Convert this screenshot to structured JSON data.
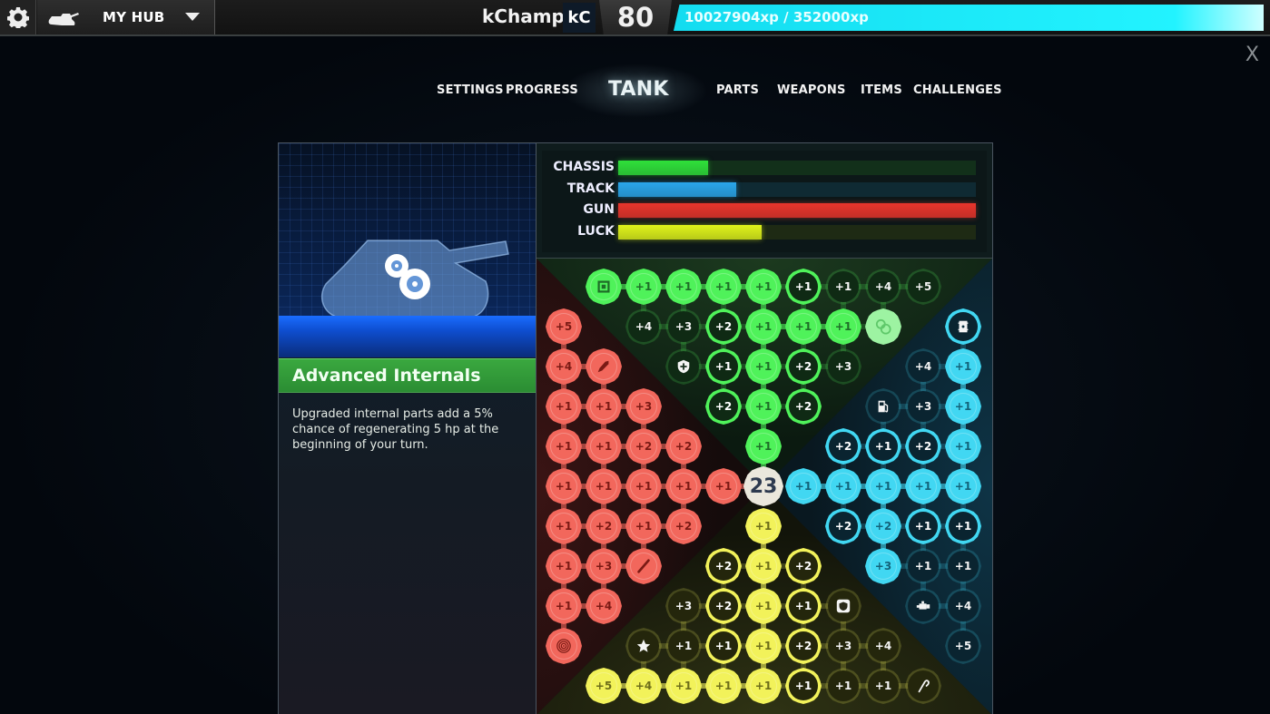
{
  "topbar": {
    "settings_icon": "gear-icon",
    "hub_icon": "tank-icon",
    "hub_label": "MY HUB",
    "hub_dropdown_icon": "caret-down-icon",
    "username": "kChamp",
    "user_badge": "kC",
    "level": "80",
    "xp_text": "10027904xp / 352000xp",
    "xp_progress_percent": 100,
    "xp_color": "#22f3ff"
  },
  "close_label": "X",
  "tabs": [
    {
      "label": "SETTINGS",
      "active": false
    },
    {
      "label": "PROGRESS",
      "active": false
    },
    {
      "label": "TANK",
      "active": true
    },
    {
      "label": "PARTS",
      "active": false
    },
    {
      "label": "WEAPONS",
      "active": false
    },
    {
      "label": "ITEMS",
      "active": false
    },
    {
      "label": "CHALLENGES",
      "active": false
    }
  ],
  "selected_part": {
    "icon": "gears-icon",
    "title": "Advanced Internals",
    "description": "Upgraded internal parts add a 5% chance of regenerating 5 hp at the beginning of your turn."
  },
  "stats": [
    {
      "label": "CHASSIS",
      "percent": 25,
      "color": "#2fe03a",
      "track": "#12301a"
    },
    {
      "label": "TRACK",
      "percent": 33,
      "color": "#2aa6ea",
      "track": "#0f2a33"
    },
    {
      "label": "GUN",
      "percent": 100,
      "color": "#e8352c",
      "track": "#301414"
    },
    {
      "label": "LUCK",
      "percent": 40,
      "color": "#dff21a",
      "track": "#1e2a14"
    }
  ],
  "colors": {
    "green": "#4ff25a",
    "red": "#f2675c",
    "cyan": "#41d7f2",
    "yellow": "#f2f25a"
  },
  "center_points": "23",
  "nodes": [
    {
      "r": 0,
      "c": 1,
      "color": "green",
      "state": "full",
      "icon": "chip-icon"
    },
    {
      "r": 0,
      "c": 2,
      "color": "green",
      "state": "full",
      "label": "+1"
    },
    {
      "r": 0,
      "c": 3,
      "color": "green",
      "state": "full",
      "label": "+1"
    },
    {
      "r": 0,
      "c": 4,
      "color": "green",
      "state": "full",
      "label": "+1"
    },
    {
      "r": 0,
      "c": 5,
      "color": "green",
      "state": "full",
      "label": "+1"
    },
    {
      "r": 0,
      "c": 6,
      "color": "green",
      "state": "mid",
      "label": "+1"
    },
    {
      "r": 0,
      "c": 7,
      "color": "green",
      "state": "dim",
      "label": "+1"
    },
    {
      "r": 0,
      "c": 8,
      "color": "green",
      "state": "dim",
      "label": "+4"
    },
    {
      "r": 0,
      "c": 9,
      "color": "green",
      "state": "dim",
      "label": "+5"
    },
    {
      "r": 1,
      "c": 0,
      "color": "red",
      "state": "full",
      "label": "+5"
    },
    {
      "r": 1,
      "c": 2,
      "color": "green",
      "state": "dim",
      "label": "+4"
    },
    {
      "r": 1,
      "c": 3,
      "color": "green",
      "state": "dim",
      "label": "+3"
    },
    {
      "r": 1,
      "c": 4,
      "color": "green",
      "state": "mid",
      "label": "+2"
    },
    {
      "r": 1,
      "c": 5,
      "color": "green",
      "state": "full",
      "label": "+1"
    },
    {
      "r": 1,
      "c": 6,
      "color": "green",
      "state": "full",
      "label": "+1"
    },
    {
      "r": 1,
      "c": 7,
      "color": "green",
      "state": "full",
      "label": "+1"
    },
    {
      "r": 1,
      "c": 8,
      "color": "green",
      "state": "selected",
      "icon": "gears-icon"
    },
    {
      "r": 1,
      "c": 10,
      "color": "cyan",
      "state": "mid",
      "icon": "barrel-icon"
    },
    {
      "r": 2,
      "c": 0,
      "color": "red",
      "state": "full",
      "label": "+4"
    },
    {
      "r": 2,
      "c": 1,
      "color": "red",
      "state": "full",
      "icon": "rocket-icon"
    },
    {
      "r": 2,
      "c": 3,
      "color": "green",
      "state": "dim",
      "icon": "shield-plus-icon"
    },
    {
      "r": 2,
      "c": 4,
      "color": "green",
      "state": "mid",
      "label": "+1"
    },
    {
      "r": 2,
      "c": 5,
      "color": "green",
      "state": "full",
      "label": "+1"
    },
    {
      "r": 2,
      "c": 6,
      "color": "green",
      "state": "mid",
      "label": "+2"
    },
    {
      "r": 2,
      "c": 7,
      "color": "green",
      "state": "dim",
      "label": "+3"
    },
    {
      "r": 2,
      "c": 9,
      "color": "cyan",
      "state": "dim",
      "label": "+4"
    },
    {
      "r": 2,
      "c": 10,
      "color": "cyan",
      "state": "full",
      "label": "+1"
    },
    {
      "r": 3,
      "c": 0,
      "color": "red",
      "state": "full",
      "label": "+1"
    },
    {
      "r": 3,
      "c": 1,
      "color": "red",
      "state": "full",
      "label": "+1"
    },
    {
      "r": 3,
      "c": 2,
      "color": "red",
      "state": "full",
      "label": "+3"
    },
    {
      "r": 3,
      "c": 4,
      "color": "green",
      "state": "mid",
      "label": "+2"
    },
    {
      "r": 3,
      "c": 5,
      "color": "green",
      "state": "full",
      "label": "+1"
    },
    {
      "r": 3,
      "c": 6,
      "color": "green",
      "state": "mid",
      "label": "+2"
    },
    {
      "r": 3,
      "c": 8,
      "color": "cyan",
      "state": "dim",
      "icon": "fuel-pump-icon"
    },
    {
      "r": 3,
      "c": 9,
      "color": "cyan",
      "state": "dim",
      "label": "+3"
    },
    {
      "r": 3,
      "c": 10,
      "color": "cyan",
      "state": "full",
      "label": "+1"
    },
    {
      "r": 4,
      "c": 0,
      "color": "red",
      "state": "full",
      "label": "+1"
    },
    {
      "r": 4,
      "c": 1,
      "color": "red",
      "state": "full",
      "label": "+1"
    },
    {
      "r": 4,
      "c": 2,
      "color": "red",
      "state": "full",
      "label": "+2"
    },
    {
      "r": 4,
      "c": 3,
      "color": "red",
      "state": "full",
      "label": "+2"
    },
    {
      "r": 4,
      "c": 5,
      "color": "green",
      "state": "full",
      "label": "+1"
    },
    {
      "r": 4,
      "c": 7,
      "color": "cyan",
      "state": "mid",
      "label": "+2"
    },
    {
      "r": 4,
      "c": 8,
      "color": "cyan",
      "state": "mid",
      "label": "+1"
    },
    {
      "r": 4,
      "c": 9,
      "color": "cyan",
      "state": "mid",
      "label": "+2"
    },
    {
      "r": 4,
      "c": 10,
      "color": "cyan",
      "state": "full",
      "label": "+1"
    },
    {
      "r": 5,
      "c": 0,
      "color": "red",
      "state": "full",
      "label": "+1"
    },
    {
      "r": 5,
      "c": 1,
      "color": "red",
      "state": "full",
      "label": "+1"
    },
    {
      "r": 5,
      "c": 2,
      "color": "red",
      "state": "full",
      "label": "+1"
    },
    {
      "r": 5,
      "c": 3,
      "color": "red",
      "state": "full",
      "label": "+1"
    },
    {
      "r": 5,
      "c": 4,
      "color": "red",
      "state": "full",
      "label": "+1"
    },
    {
      "r": 5,
      "c": 6,
      "color": "cyan",
      "state": "full",
      "label": "+1"
    },
    {
      "r": 5,
      "c": 7,
      "color": "cyan",
      "state": "full",
      "label": "+1"
    },
    {
      "r": 5,
      "c": 8,
      "color": "cyan",
      "state": "full",
      "label": "+1"
    },
    {
      "r": 5,
      "c": 9,
      "color": "cyan",
      "state": "full",
      "label": "+1"
    },
    {
      "r": 5,
      "c": 10,
      "color": "cyan",
      "state": "full",
      "label": "+1"
    },
    {
      "r": 6,
      "c": 0,
      "color": "red",
      "state": "full",
      "label": "+1"
    },
    {
      "r": 6,
      "c": 1,
      "color": "red",
      "state": "full",
      "label": "+2"
    },
    {
      "r": 6,
      "c": 2,
      "color": "red",
      "state": "full",
      "label": "+1"
    },
    {
      "r": 6,
      "c": 3,
      "color": "red",
      "state": "full",
      "label": "+2"
    },
    {
      "r": 6,
      "c": 5,
      "color": "yellow",
      "state": "full",
      "label": "+1"
    },
    {
      "r": 6,
      "c": 7,
      "color": "cyan",
      "state": "mid",
      "label": "+2"
    },
    {
      "r": 6,
      "c": 8,
      "color": "cyan",
      "state": "full",
      "label": "+2"
    },
    {
      "r": 6,
      "c": 9,
      "color": "cyan",
      "state": "mid",
      "label": "+1"
    },
    {
      "r": 6,
      "c": 10,
      "color": "cyan",
      "state": "mid",
      "label": "+1"
    },
    {
      "r": 7,
      "c": 0,
      "color": "red",
      "state": "full",
      "label": "+1"
    },
    {
      "r": 7,
      "c": 1,
      "color": "red",
      "state": "full",
      "label": "+3"
    },
    {
      "r": 7,
      "c": 2,
      "color": "red",
      "state": "full",
      "icon": "syringe-icon"
    },
    {
      "r": 7,
      "c": 4,
      "color": "yellow",
      "state": "mid",
      "label": "+2"
    },
    {
      "r": 7,
      "c": 5,
      "color": "yellow",
      "state": "full",
      "label": "+1"
    },
    {
      "r": 7,
      "c": 6,
      "color": "yellow",
      "state": "mid",
      "label": "+2"
    },
    {
      "r": 7,
      "c": 8,
      "color": "cyan",
      "state": "full",
      "label": "+3"
    },
    {
      "r": 7,
      "c": 9,
      "color": "cyan",
      "state": "dim",
      "label": "+1"
    },
    {
      "r": 7,
      "c": 10,
      "color": "cyan",
      "state": "dim",
      "label": "+1"
    },
    {
      "r": 8,
      "c": 0,
      "color": "red",
      "state": "full",
      "label": "+1"
    },
    {
      "r": 8,
      "c": 1,
      "color": "red",
      "state": "full",
      "label": "+4"
    },
    {
      "r": 8,
      "c": 3,
      "color": "yellow",
      "state": "dim",
      "label": "+3"
    },
    {
      "r": 8,
      "c": 4,
      "color": "yellow",
      "state": "mid",
      "label": "+2"
    },
    {
      "r": 8,
      "c": 5,
      "color": "yellow",
      "state": "full",
      "label": "+1"
    },
    {
      "r": 8,
      "c": 6,
      "color": "yellow",
      "state": "mid",
      "label": "+1"
    },
    {
      "r": 8,
      "c": 7,
      "color": "yellow",
      "state": "dim",
      "icon": "badge-shield-icon"
    },
    {
      "r": 8,
      "c": 9,
      "color": "cyan",
      "state": "dim",
      "icon": "engine-icon"
    },
    {
      "r": 8,
      "c": 10,
      "color": "cyan",
      "state": "dim",
      "label": "+4"
    },
    {
      "r": 9,
      "c": 0,
      "color": "red",
      "state": "full",
      "icon": "target-swirl-icon"
    },
    {
      "r": 9,
      "c": 2,
      "color": "yellow",
      "state": "dim",
      "icon": "star-icon"
    },
    {
      "r": 9,
      "c": 3,
      "color": "yellow",
      "state": "dim",
      "label": "+1"
    },
    {
      "r": 9,
      "c": 4,
      "color": "yellow",
      "state": "mid",
      "label": "+1"
    },
    {
      "r": 9,
      "c": 5,
      "color": "yellow",
      "state": "full",
      "label": "+1"
    },
    {
      "r": 9,
      "c": 6,
      "color": "yellow",
      "state": "mid",
      "label": "+2"
    },
    {
      "r": 9,
      "c": 7,
      "color": "yellow",
      "state": "dim",
      "label": "+3"
    },
    {
      "r": 9,
      "c": 8,
      "color": "yellow",
      "state": "dim",
      "label": "+4"
    },
    {
      "r": 9,
      "c": 10,
      "color": "cyan",
      "state": "dim",
      "label": "+5"
    },
    {
      "r": 10,
      "c": 1,
      "color": "yellow",
      "state": "full",
      "label": "+5"
    },
    {
      "r": 10,
      "c": 2,
      "color": "yellow",
      "state": "full",
      "label": "+4"
    },
    {
      "r": 10,
      "c": 3,
      "color": "yellow",
      "state": "full",
      "label": "+1"
    },
    {
      "r": 10,
      "c": 4,
      "color": "yellow",
      "state": "full",
      "label": "+1"
    },
    {
      "r": 10,
      "c": 5,
      "color": "yellow",
      "state": "full",
      "label": "+1"
    },
    {
      "r": 10,
      "c": 6,
      "color": "yellow",
      "state": "mid",
      "label": "+1"
    },
    {
      "r": 10,
      "c": 7,
      "color": "yellow",
      "state": "dim",
      "label": "+1"
    },
    {
      "r": 10,
      "c": 8,
      "color": "yellow",
      "state": "dim",
      "label": "+1"
    },
    {
      "r": 10,
      "c": 9,
      "color": "yellow",
      "state": "dim",
      "icon": "hook-icon"
    }
  ]
}
